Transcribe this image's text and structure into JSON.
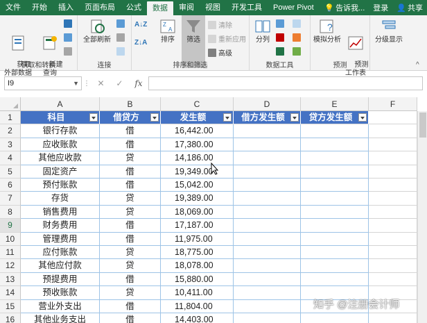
{
  "menu": {
    "tabs": [
      "文件",
      "开始",
      "插入",
      "页面布局",
      "公式",
      "数据",
      "审阅",
      "视图",
      "开发工具",
      "Power Pivot"
    ],
    "active_tab": "数据",
    "tell_me": "告诉我...",
    "login": "登录",
    "share": "共享"
  },
  "ribbon": {
    "get_external": "获取\n外部数据",
    "new_query": "新建\n查询",
    "group_get_transform": "获取和转换",
    "refresh_all": "全部刷新",
    "group_connections": "连接",
    "sort": "排序",
    "filter": "筛选",
    "clear": "清除",
    "reapply": "重新应用",
    "advanced": "高级",
    "group_sort_filter": "排序和筛选",
    "split": "分列",
    "group_data_tools": "数据工具",
    "what_if": "模拟分析",
    "forecast_sheet": "预测\n工作表",
    "group_forecast": "预测",
    "outline": "分级显示"
  },
  "formula_bar": {
    "name_box": "I9",
    "fx": "fx",
    "value": ""
  },
  "columns": [
    "A",
    "B",
    "C",
    "D",
    "E",
    "F"
  ],
  "table": {
    "headers": [
      "科目",
      "借贷方",
      "发生额",
      "借方发生额",
      "贷方发生额"
    ],
    "rows": [
      {
        "subject": "银行存款",
        "dc": "借",
        "amount": "16,442.00"
      },
      {
        "subject": "应收账款",
        "dc": "借",
        "amount": "17,380.00"
      },
      {
        "subject": "其他应收款",
        "dc": "贷",
        "amount": "14,186.00"
      },
      {
        "subject": "固定资产",
        "dc": "借",
        "amount": "19,349.00"
      },
      {
        "subject": "预付账款",
        "dc": "借",
        "amount": "15,042.00"
      },
      {
        "subject": "存货",
        "dc": "贷",
        "amount": "19,389.00"
      },
      {
        "subject": "销售费用",
        "dc": "贷",
        "amount": "18,069.00"
      },
      {
        "subject": "财务费用",
        "dc": "借",
        "amount": "17,187.00"
      },
      {
        "subject": "管理费用",
        "dc": "借",
        "amount": "11,975.00"
      },
      {
        "subject": "应付账款",
        "dc": "贷",
        "amount": "18,775.00"
      },
      {
        "subject": "其他应付款",
        "dc": "贷",
        "amount": "18,078.00"
      },
      {
        "subject": "预提费用",
        "dc": "借",
        "amount": "15,880.00"
      },
      {
        "subject": "预收账款",
        "dc": "贷",
        "amount": "10,411.00"
      },
      {
        "subject": "营业外支出",
        "dc": "借",
        "amount": "11,804.00"
      },
      {
        "subject": "其他业务支出",
        "dc": "借",
        "amount": "14,403.00"
      }
    ]
  },
  "row_numbers": [
    "1",
    "2",
    "3",
    "4",
    "5",
    "6",
    "7",
    "8",
    "9",
    "10",
    "11",
    "12",
    "13",
    "14",
    "15",
    "16"
  ],
  "selected_row": "9",
  "watermark": "知乎 @注册会计师",
  "colors": {
    "excel_green": "#217346",
    "table_header": "#4472c4",
    "table_border": "#9dc3e6"
  }
}
